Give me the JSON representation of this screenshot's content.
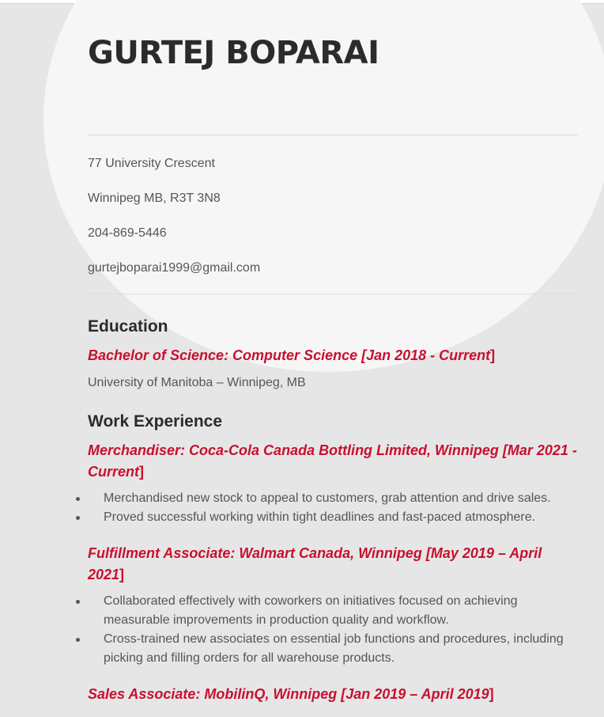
{
  "name": "GURTEJ BOPARAI",
  "contact": {
    "address_line1": "77 University Crescent",
    "address_line2": "Winnipeg MB, R3T 3N8",
    "phone": "204-869-5446",
    "email": "gurtejboparai1999@gmail.com"
  },
  "education": {
    "heading": "Education",
    "degree": "Bachelor of Science: Computer Science [Jan 2018 - Current",
    "degree_close": "]",
    "school": "University of Manitoba – Winnipeg, MB"
  },
  "work": {
    "heading": "Work Experience",
    "jobs": [
      {
        "title": "Merchandiser: Coca-Cola Canada Bottling Limited, Winnipeg [Mar 2021 - Current",
        "close": "]",
        "bullets": [
          "Merchandised new stock to appeal to customers, grab attention and drive sales.",
          "Proved successful working within tight deadlines and fast-paced atmosphere."
        ]
      },
      {
        "title": "Fulfillment Associate: Walmart Canada, Winnipeg [May 2019 – April 2021",
        "close": "]",
        "bullets": [
          "Collaborated effectively with coworkers on initiatives focused on achieving measurable improvements in production quality and workflow.",
          "Cross-trained new associates on essential job functions and procedures, including picking and filling orders for all warehouse products."
        ]
      },
      {
        "title": "Sales Associate: MobilinQ, Winnipeg [Jan 2019 – April 2019",
        "close": "]"
      }
    ]
  }
}
